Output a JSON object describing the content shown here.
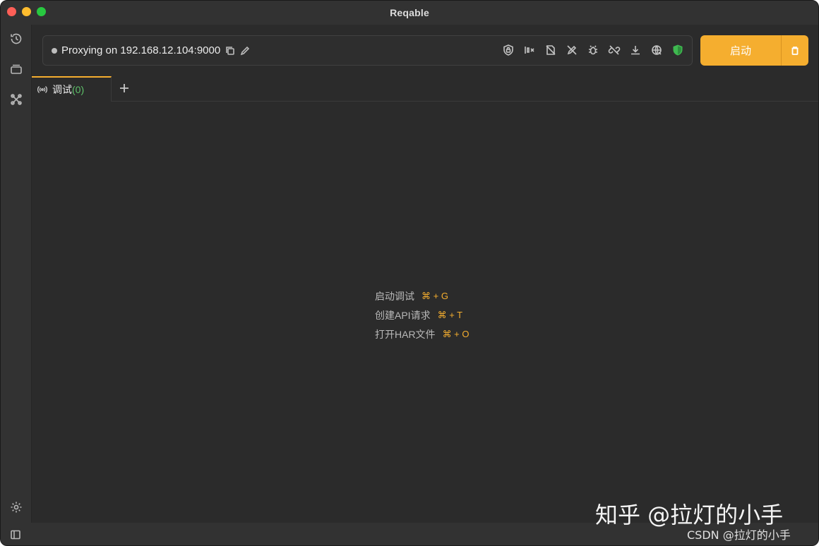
{
  "window": {
    "title": "Reqable"
  },
  "toolbar": {
    "proxy_status": "Proxying on 192.168.12.104:9000",
    "start_button": "启动"
  },
  "tabs": [
    {
      "label": "调试",
      "count": "(0)"
    }
  ],
  "shortcuts": [
    {
      "label": "启动调试",
      "key": "⌘ + G"
    },
    {
      "label": "创建API请求",
      "key": "⌘ + T"
    },
    {
      "label": "打开HAR文件",
      "key": "⌘ + O"
    }
  ],
  "watermark": {
    "primary": "知乎 @拉灯的小手",
    "secondary": "CSDN @拉灯的小手"
  },
  "colors": {
    "accent": "#f5ae2f",
    "background": "#2b2b2b",
    "count_green": "#5ec26a",
    "shield_green": "#3fb950"
  }
}
